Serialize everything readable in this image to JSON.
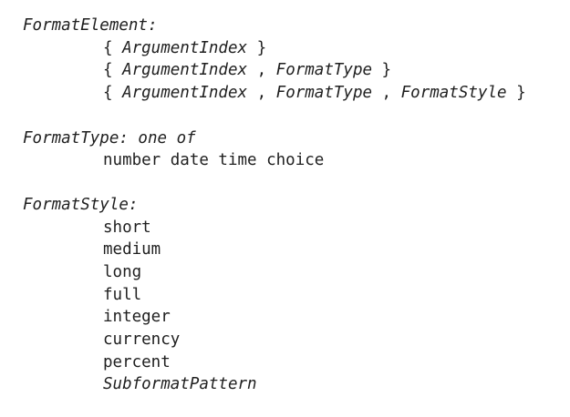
{
  "format_element": {
    "heading": "FormatElement:",
    "rules": [
      [
        "{ ",
        "ArgumentIndex",
        " }"
      ],
      [
        "{ ",
        "ArgumentIndex",
        " , ",
        "FormatType",
        " }"
      ],
      [
        "{ ",
        "ArgumentIndex",
        " , ",
        "FormatType",
        " , ",
        "FormatStyle",
        " }"
      ]
    ]
  },
  "format_type": {
    "heading": "FormatType: one of",
    "values": "number date time choice"
  },
  "format_style": {
    "heading": "FormatStyle:",
    "values": [
      "short",
      "medium",
      "long",
      "full",
      "integer",
      "currency",
      "percent"
    ],
    "last_value": "SubformatPattern"
  }
}
